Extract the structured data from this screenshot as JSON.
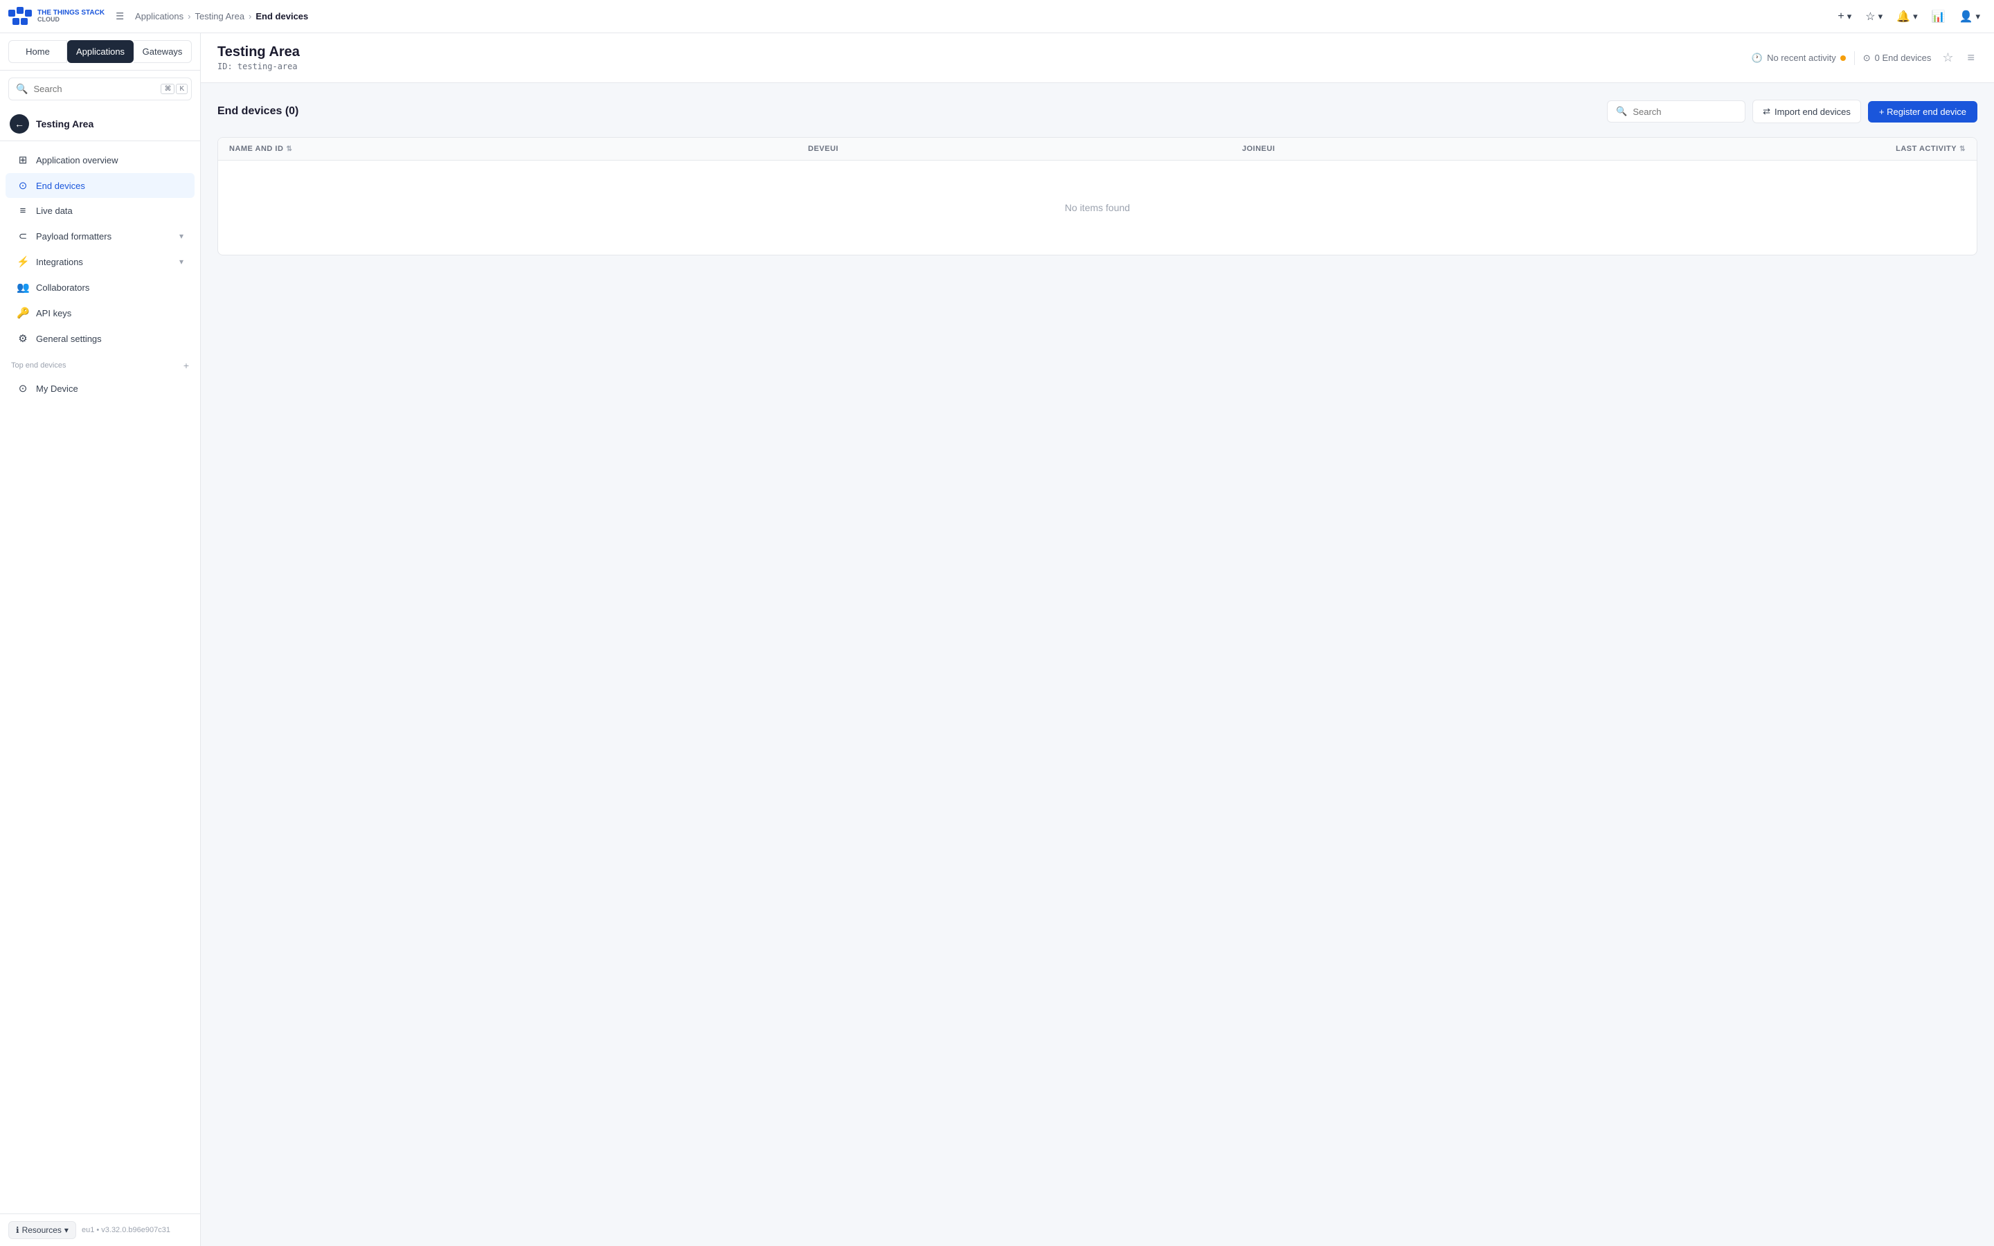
{
  "logo": {
    "brand": "THE THINGS STACK",
    "type": "CLOUD"
  },
  "topNav": {
    "breadcrumbs": [
      {
        "label": "Applications",
        "href": "#"
      },
      {
        "label": "Testing Area",
        "href": "#"
      },
      {
        "label": "End devices",
        "current": true
      }
    ],
    "buttons": {
      "add": "+",
      "addChevron": "▾",
      "star": "☆",
      "starChevron": "▾",
      "notifications": "🔔",
      "notificationsChevron": "▾",
      "barChart": "📊",
      "user": "👤",
      "userChevron": "▾"
    }
  },
  "sidebar": {
    "navButtons": [
      {
        "label": "Home",
        "active": false
      },
      {
        "label": "Applications",
        "active": true
      },
      {
        "label": "Gateways",
        "active": false
      }
    ],
    "search": {
      "placeholder": "Search",
      "shortcut1": "⌘",
      "shortcut2": "K"
    },
    "backLabel": "Testing Area",
    "navItems": [
      {
        "id": "app-overview",
        "label": "Application overview",
        "icon": "⊞",
        "active": false
      },
      {
        "id": "end-devices",
        "label": "End devices",
        "icon": "⊙",
        "active": true
      },
      {
        "id": "live-data",
        "label": "Live data",
        "icon": "≡",
        "active": false
      },
      {
        "id": "payload-formatters",
        "label": "Payload formatters",
        "icon": "⊂",
        "active": false,
        "hasChevron": true
      },
      {
        "id": "integrations",
        "label": "Integrations",
        "icon": "⚡",
        "active": false,
        "hasChevron": true
      },
      {
        "id": "collaborators",
        "label": "Collaborators",
        "icon": "👥",
        "active": false
      },
      {
        "id": "api-keys",
        "label": "API keys",
        "icon": "🔑",
        "active": false
      },
      {
        "id": "general-settings",
        "label": "General settings",
        "icon": "⚙",
        "active": false
      }
    ],
    "topEndDevicesLabel": "Top end devices",
    "topEndDevices": [
      {
        "id": "my-device",
        "label": "My Device",
        "icon": "⊙"
      }
    ],
    "footer": {
      "resourcesLabel": "Resources",
      "resourcesIcon": "ℹ",
      "chevron": "▾",
      "version": "eu1 • v3.32.0.b96e907c31"
    }
  },
  "contentHeader": {
    "title": "Testing Area",
    "id": "ID: testing-area",
    "noRecentActivity": "No recent activity",
    "endDevicesCount": "0 End devices",
    "starIcon": "☆",
    "menuIcon": "≡"
  },
  "devicesSection": {
    "title": "End devices (0)",
    "searchPlaceholder": "Search",
    "importLabel": "Import end devices",
    "importIcon": "⇄",
    "registerLabel": "+ Register end device",
    "tableColumns": {
      "nameAndId": "NAME AND ID",
      "devEui": "DEVEUI",
      "joinEui": "JOINEUI",
      "lastActivity": "LAST ACTIVITY"
    },
    "emptyMessage": "No items found"
  }
}
